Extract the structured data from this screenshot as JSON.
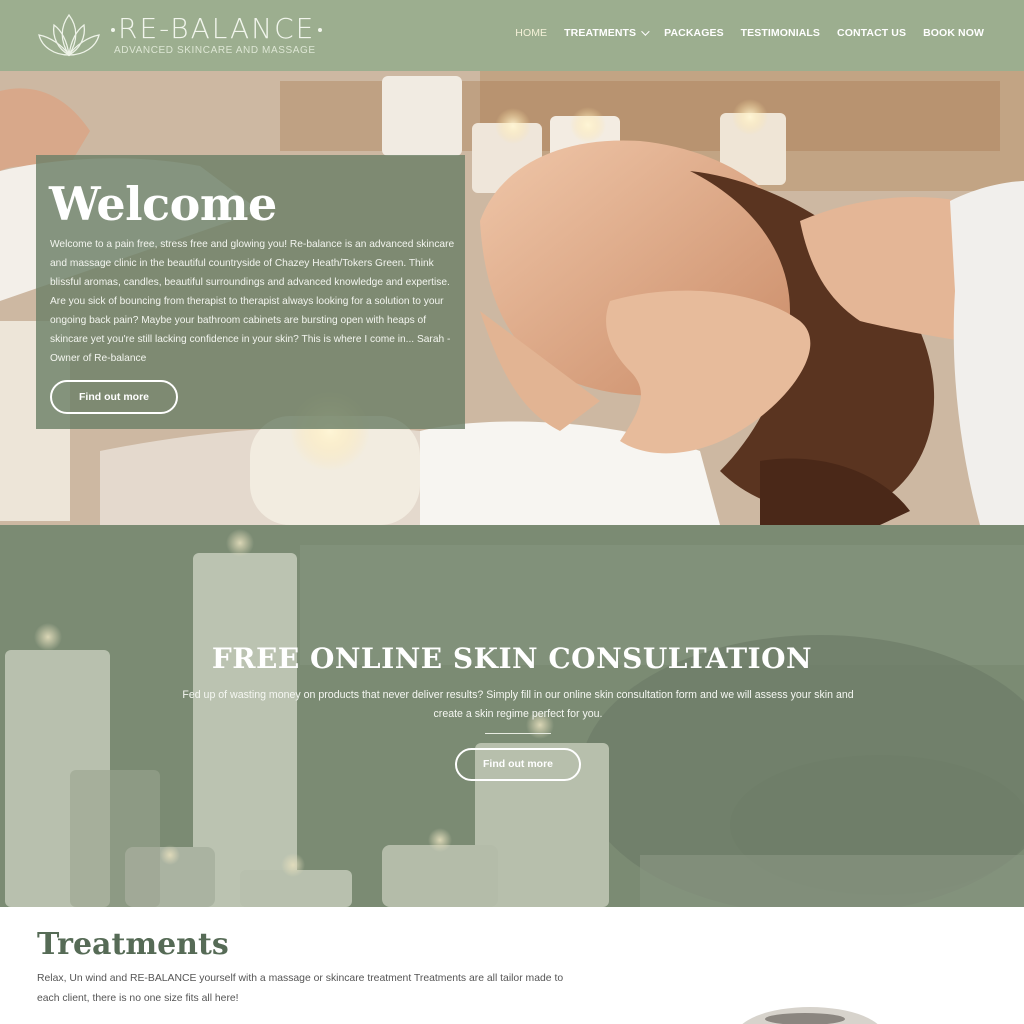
{
  "header": {
    "logo": {
      "icon": "lotus-logo-icon",
      "title": "RE-BALANCE",
      "subtitle": "ADVANCED SKINCARE AND MASSAGE"
    },
    "nav": [
      {
        "label": "HOME",
        "active": true
      },
      {
        "label": "TREATMENTS",
        "has_dropdown": true
      },
      {
        "label": "PACKAGES"
      },
      {
        "label": "TESTIMONIALS"
      },
      {
        "label": "CONTACT US"
      },
      {
        "label": "BOOK NOW"
      }
    ]
  },
  "hero": {
    "title": "Welcome",
    "text": "Welcome to a pain free, stress free and glowing you! Re-balance is an advanced skincare and massage clinic in the beautiful countryside of Chazey Heath/Tokers Green. Think blissful aromas, candles, beautiful surroundings and advanced knowledge and expertise. Are you sick of bouncing from therapist to therapist always looking for a solution to your ongoing back pain? Maybe your bathroom cabinets are bursting open with heaps of skincare yet you're still lacking confidence in your skin? This is where I come in... Sarah - Owner of Re-balance",
    "button": "Find out more"
  },
  "consultation": {
    "title": "FREE ONLINE SKIN CONSULTATION",
    "text": "Fed up of wasting money on products that never deliver results? Simply fill in our online skin consultation form and we will assess your skin and create a skin regime perfect for you.",
    "button": "Find out more"
  },
  "treatments": {
    "title": "Treatments",
    "text": "Relax, Un wind and RE-BALANCE yourself with a massage or skincare treatment Treatments are all tailor made to each client, there is no one size fits all here!"
  },
  "colors": {
    "header_bg": "#9cae8f",
    "welcome_box": "#6c8068",
    "consult_overlay": "#7f8f78",
    "heading_green": "#566b56"
  }
}
